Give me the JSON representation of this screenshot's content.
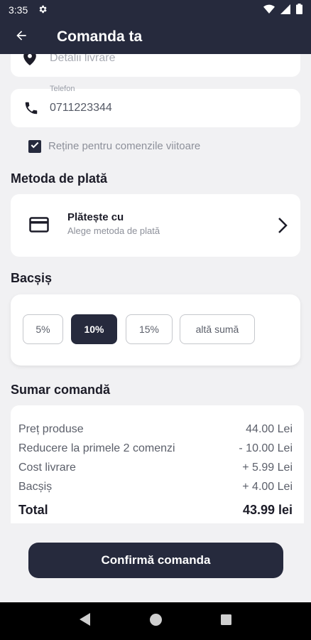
{
  "status": {
    "time": "3:35"
  },
  "appbar": {
    "title": "Comanda ta"
  },
  "address": {
    "placeholder": "Detalii livrare"
  },
  "phone": {
    "label": "Telefon",
    "value": "0711223344"
  },
  "remember": {
    "label": "Reține pentru comenzile viitoare",
    "checked": true
  },
  "payment": {
    "section_title": "Metoda de plată",
    "title": "Plătește cu",
    "subtitle": "Alege metoda de plată"
  },
  "tip": {
    "section_title": "Bacșiș",
    "options": [
      {
        "label": "5%",
        "selected": false
      },
      {
        "label": "10%",
        "selected": true
      },
      {
        "label": "15%",
        "selected": false
      },
      {
        "label": "altă sumă",
        "selected": false
      }
    ]
  },
  "summary": {
    "section_title": "Sumar comandă",
    "rows": [
      {
        "label": "Preț produse",
        "value": "44.00 Lei"
      },
      {
        "label": "Reducere la primele 2 comenzi",
        "value": "- 10.00 Lei"
      },
      {
        "label": "Cost livrare",
        "value": "+ 5.99 Lei"
      },
      {
        "label": "Bacșiș",
        "value": "+ 4.00 Lei"
      }
    ],
    "total": {
      "label": "Total",
      "value": "43.99 lei"
    }
  },
  "confirm_label": "Confirmă comanda",
  "colors": {
    "primary": "#262a3d",
    "background": "#f1f1f3",
    "card": "#ffffff"
  },
  "icons": [
    "settings-icon",
    "wifi-icon",
    "signal-icon",
    "battery-icon",
    "back-arrow-icon",
    "location-pin-icon",
    "phone-icon",
    "checkmark-icon",
    "credit-card-icon",
    "chevron-right-icon",
    "nav-back-icon",
    "nav-home-icon",
    "nav-recents-icon"
  ]
}
